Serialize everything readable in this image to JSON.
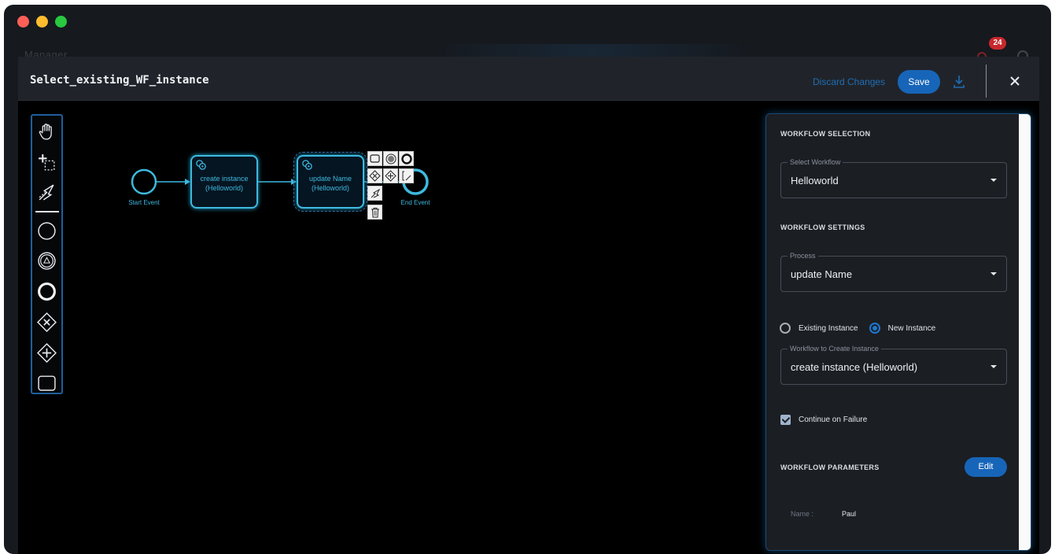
{
  "window": {
    "background_app": "Manager",
    "notification_count": "24"
  },
  "modal": {
    "title": "Select_existing_WF_instance",
    "discard_label": "Discard Changes",
    "save_label": "Save"
  },
  "palette": {
    "tools": [
      "hand-tool-icon",
      "lasso-tool-icon",
      "connect-tool-icon",
      "start-event-icon",
      "intermediate-event-icon",
      "end-event-icon",
      "exclusive-gateway-icon",
      "parallel-gateway-icon",
      "task-icon"
    ]
  },
  "diagram": {
    "start_event_label": "Start Event",
    "task1_label": "create instance (Helloworld)",
    "task2_label": "update Name (Helloworld)",
    "end_event_label": "End Event"
  },
  "panel": {
    "workflow_selection_title": "WORKFLOW SELECTION",
    "select_workflow_label": "Select Workflow",
    "select_workflow_value": "Helloworld",
    "workflow_settings_title": "WORKFLOW SETTINGS",
    "process_label": "Process",
    "process_value": "update Name",
    "radio_existing": "Existing Instance",
    "radio_new": "New Instance",
    "selected_instance_mode": "New Instance",
    "create_instance_label": "Workflow to Create Instance",
    "create_instance_value": "create instance (Helloworld)",
    "continue_on_failure_label": "Continue on Failure",
    "continue_on_failure_checked": true,
    "parameters_title": "WORKFLOW PARAMETERS",
    "edit_label": "Edit",
    "param_name_key": "Name :",
    "param_name_value": "Paul"
  },
  "colors": {
    "accent": "#1765b8",
    "diagram": "#3eb9df",
    "notification": "#c8282d"
  }
}
